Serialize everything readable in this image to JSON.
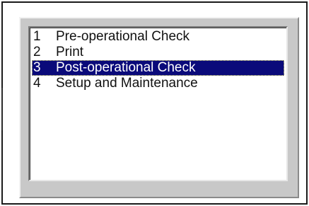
{
  "menu": {
    "items": [
      {
        "number": "1",
        "label": "Pre-operational Check",
        "selected": false
      },
      {
        "number": "2",
        "label": "Print",
        "selected": false
      },
      {
        "number": "3",
        "label": "Post-operational Check",
        "selected": true
      },
      {
        "number": "4",
        "label": "Setup and Maintenance",
        "selected": false
      }
    ],
    "selected_index": 2
  },
  "colors": {
    "selection_background": "#0a0a7a",
    "selection_text": "#ffffff",
    "panel_background": "#c8c8c8",
    "list_background": "#ffffff"
  }
}
